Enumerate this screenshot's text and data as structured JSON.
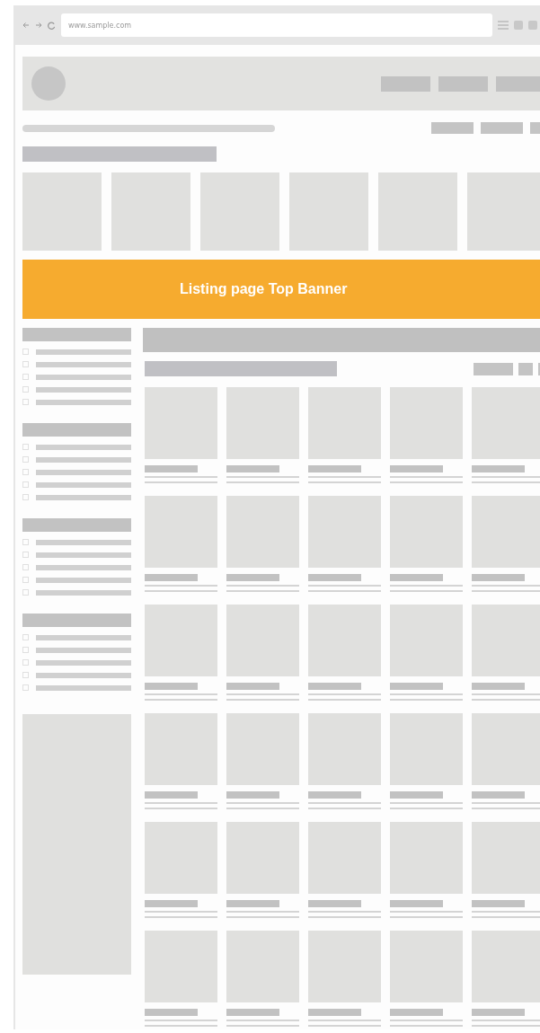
{
  "browser": {
    "url": "www.sample.com"
  },
  "banner": {
    "title": "Listing page Top Banner"
  },
  "filter_groups": [
    {
      "options": [
        {
          "checked": false
        },
        {
          "checked": false
        },
        {
          "checked": false
        },
        {
          "checked": false
        },
        {
          "checked": false
        }
      ]
    },
    {
      "options": [
        {
          "checked": false
        },
        {
          "checked": false
        },
        {
          "checked": false
        },
        {
          "checked": false
        },
        {
          "checked": false
        }
      ]
    },
    {
      "options": [
        {
          "checked": false
        },
        {
          "checked": false
        },
        {
          "checked": false
        },
        {
          "checked": false
        },
        {
          "checked": false
        }
      ]
    },
    {
      "options": [
        {
          "checked": false
        },
        {
          "checked": false
        },
        {
          "checked": false
        },
        {
          "checked": false
        },
        {
          "checked": false
        }
      ]
    }
  ]
}
